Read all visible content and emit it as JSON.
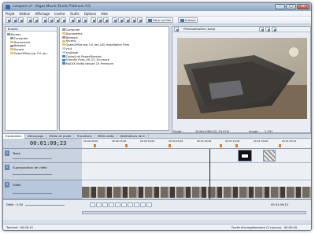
{
  "window": {
    "title": "compare.vf - Vegas Movie Studio Platinum 9.0",
    "minimize_glyph": "–",
    "maximize_glyph": "□",
    "close_glyph": "×"
  },
  "menu": [
    "Projet",
    "Edition",
    "Affichage",
    "Insérer",
    "Outils",
    "Options",
    "Aide"
  ],
  "toolbar": {
    "make_movie_label": "Faire un film",
    "autosave_label": "Autove"
  },
  "explorer": {
    "header_label": "Bureau",
    "tree": [
      "Bureau",
      "Computer",
      "Documents",
      "Network",
      "Favoris",
      "OpenOffice.org 3.0 (en-"
    ],
    "files": [
      "Computer",
      "Documents",
      "Network",
      "Favoris",
      "OpenOffice.org 3.0 (en-US) Installation Files",
      "vlc4",
      "ecolloge",
      "CyberLink PowerDirector",
      "Friendly Fires_00_07_Ec:nsock",
      "MAGIX Vidéo deluxe 15 Premium"
    ]
  },
  "preview": {
    "mode_label": "Prévisualisation (Auto)",
    "project_label": "Projet :",
    "project_value": "1440x1080x32, 29,970i",
    "preview_label": "Prévisualisation :",
    "preview_value": "360x270x32, 29,970p",
    "image_label": "Image :",
    "image_value": "2 091",
    "display_label": "Affichage :",
    "display_value": "360x270x32"
  },
  "tabs": [
    {
      "label": "Explorateur",
      "active": true
    },
    {
      "label": "Découpage",
      "active": false
    },
    {
      "label": "Média de projet",
      "active": false
    },
    {
      "label": "Transitions",
      "active": false
    },
    {
      "label": "Effets vidéo",
      "active": false
    },
    {
      "label": "Générateurs de m",
      "active": false
    }
  ],
  "timeline": {
    "timecode": "00:01:09;23",
    "ruler": [
      "00:00:00;00",
      "00:00:15;00",
      "00:00:30;00",
      "00:00:45;00",
      "00:01:00;00",
      "00:01:15;00",
      "00:01:30;00",
      "00:01:45;00"
    ],
    "tracks": [
      {
        "num": "1",
        "name": "Texte"
      },
      {
        "num": "2",
        "name": "Superposition de vidéo"
      },
      {
        "num": "3",
        "name": "Vidéo"
      }
    ],
    "rate_label": "Débit : 0,00",
    "end_time": "00:01:09;23"
  },
  "status": {
    "left": "Terminé : 00:00:10",
    "right": "Durée d'enregistrement (2 canaux) : 00:00:00"
  }
}
